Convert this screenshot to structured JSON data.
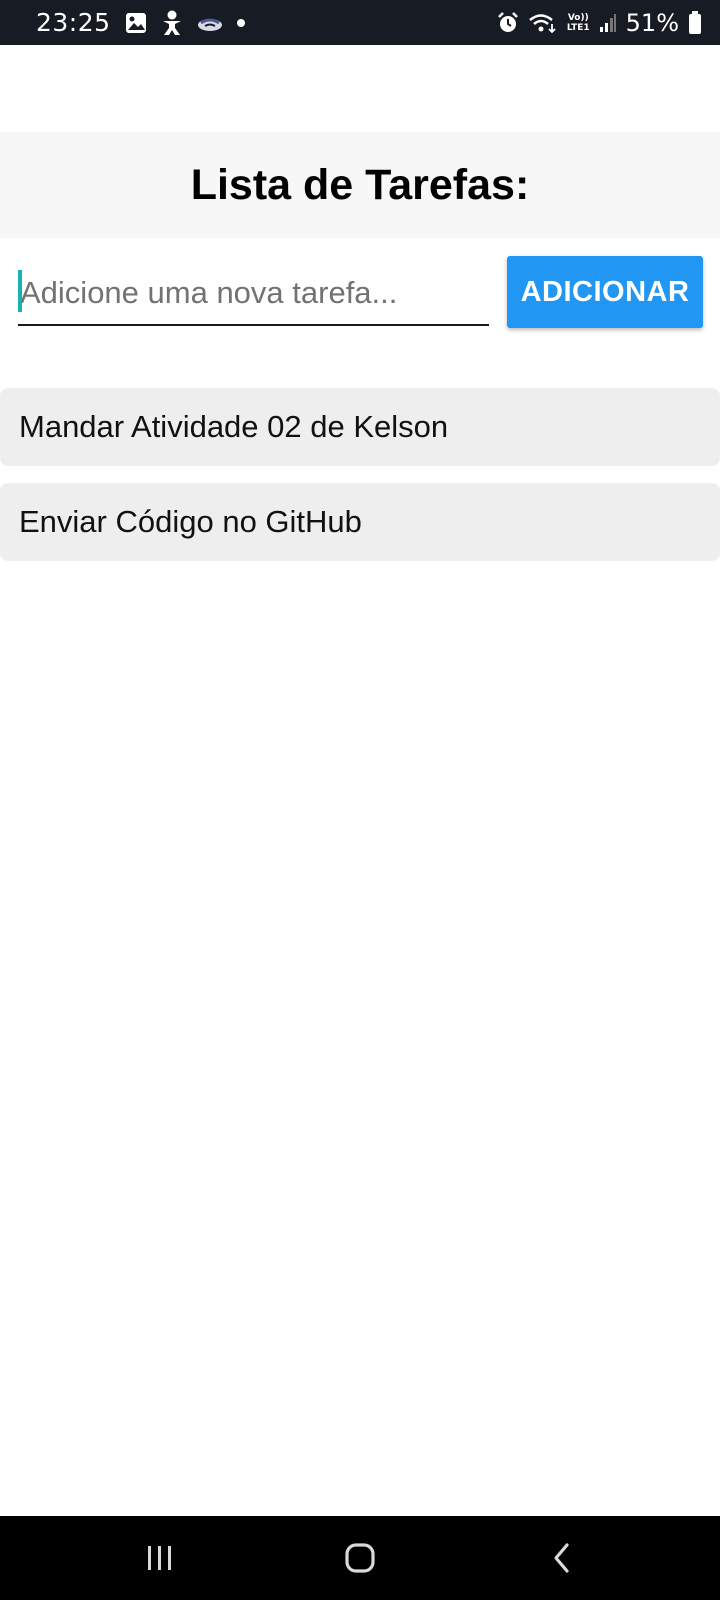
{
  "status_bar": {
    "time": "23:25",
    "battery": "51%",
    "volte_top": "Vo))",
    "volte_bottom": "LTE1",
    "left_icons": [
      "image-icon",
      "person-icon",
      "handshake-icon",
      "notification-dot-icon"
    ],
    "right_icons": [
      "alarm-icon",
      "wifi-icon",
      "volte-icon",
      "signal-icon",
      "battery-icon"
    ]
  },
  "header": {
    "title": "Lista de Tarefas:"
  },
  "input": {
    "placeholder": "Adicione uma nova tarefa...",
    "value": ""
  },
  "add_button": {
    "label": "ADICIONAR"
  },
  "tasks": [
    {
      "text": "Mandar Atividade 02 de Kelson"
    },
    {
      "text": "Enviar Código no GitHub"
    }
  ],
  "nav_bar": {
    "icons": [
      "recents-icon",
      "home-icon",
      "back-icon"
    ]
  },
  "colors": {
    "accent": "#2196f3",
    "caret": "#17b3b0",
    "header_bg": "#f7f7f7",
    "task_bg": "#eeeeee",
    "status_bar_bg": "#171b23"
  }
}
